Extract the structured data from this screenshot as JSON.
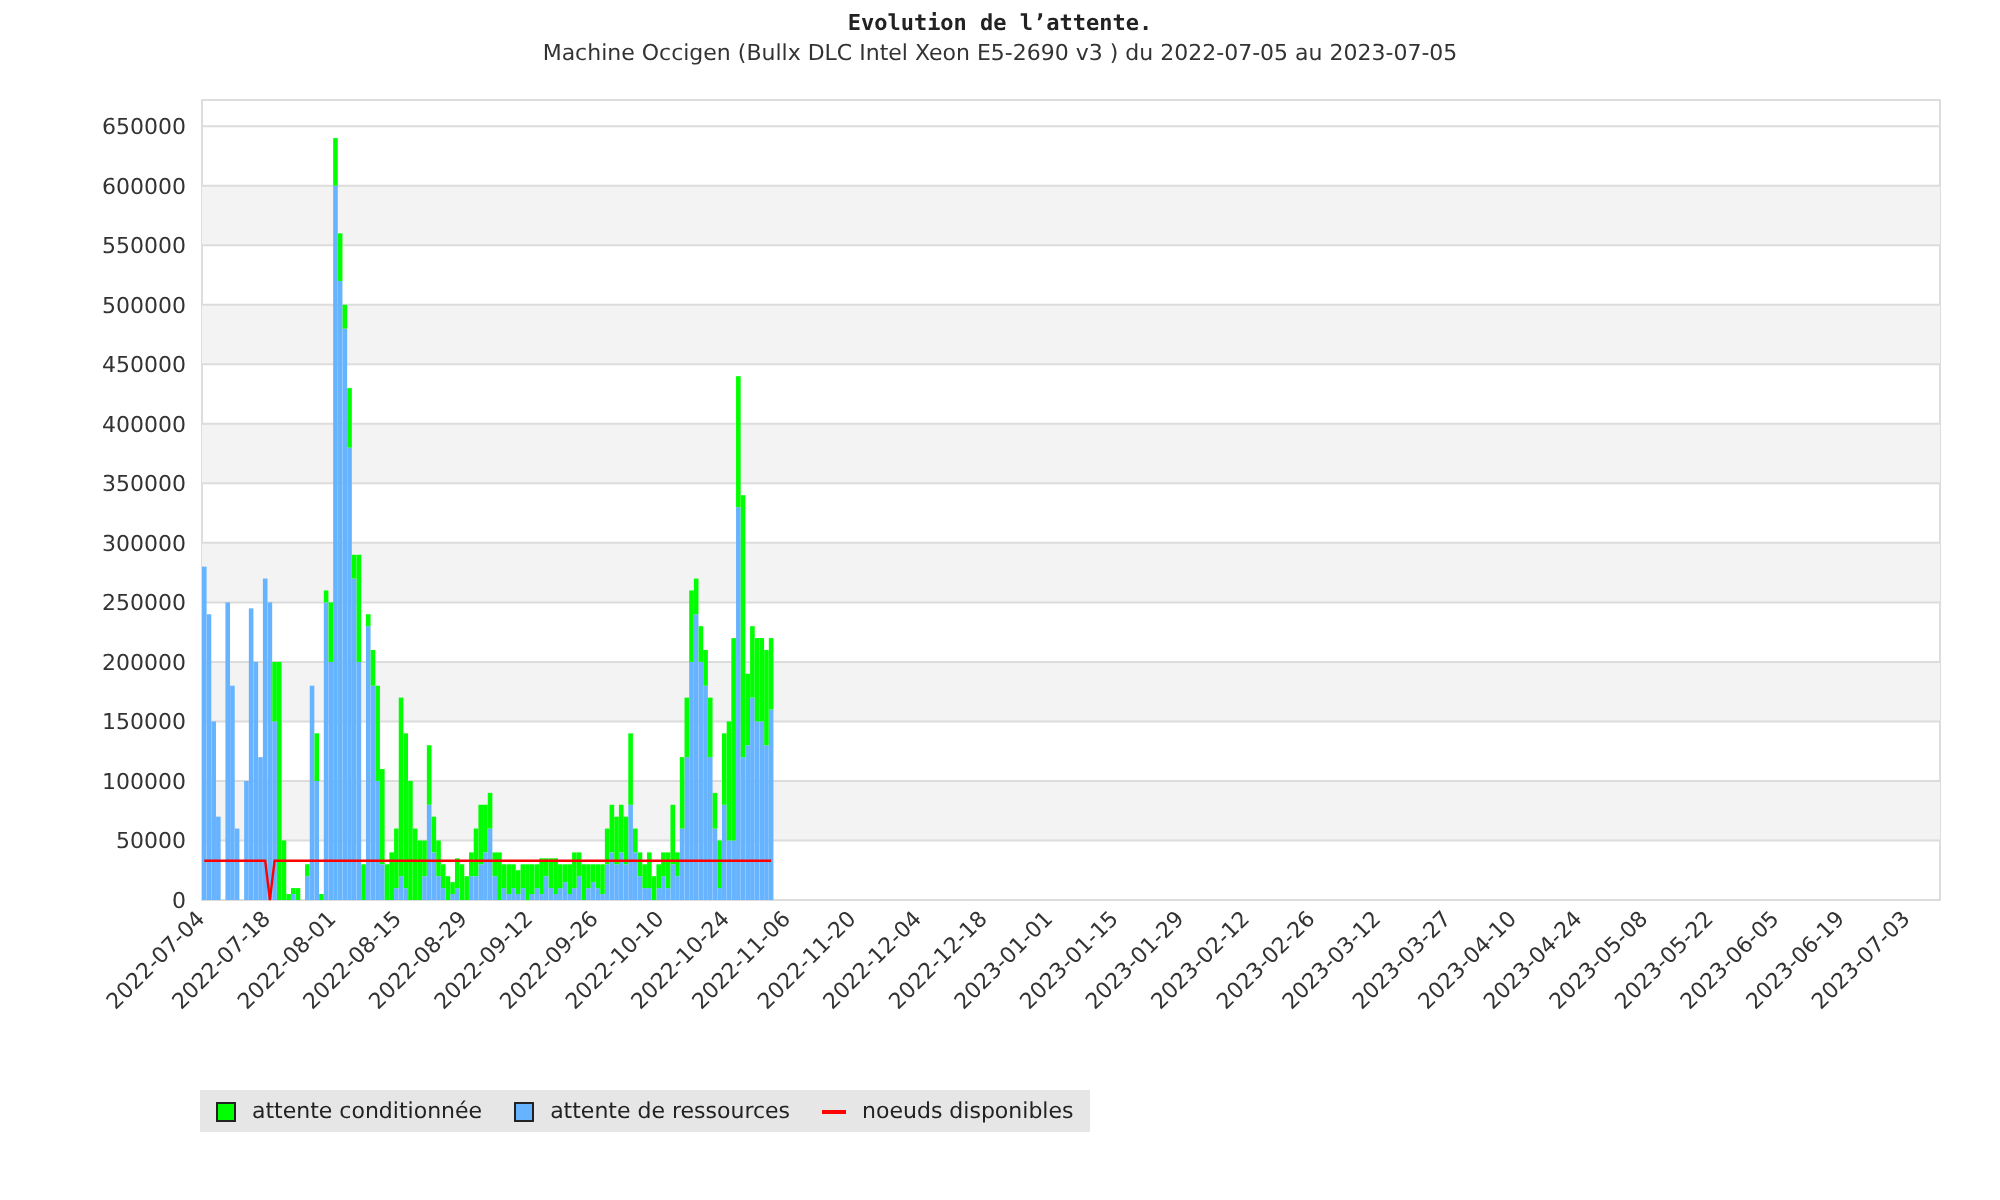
{
  "title": "Evolution de l’attente.",
  "subtitle": "Machine Occigen (Bullx DLC  Intel Xeon E5-2690 v3 ) du 2022-07-05 au 2023-07-05",
  "chart_data": {
    "type": "bar",
    "stacked": true,
    "grid": true,
    "categories": [
      "2022-07-04",
      null,
      null,
      null,
      null,
      null,
      null,
      null,
      null,
      null,
      null,
      null,
      null,
      null,
      "2022-07-18",
      null,
      null,
      null,
      null,
      null,
      null,
      null,
      null,
      null,
      null,
      null,
      null,
      null,
      "2022-08-01",
      null,
      null,
      null,
      null,
      null,
      null,
      null,
      null,
      null,
      null,
      null,
      null,
      null,
      "2022-08-15",
      null,
      null,
      null,
      null,
      null,
      null,
      null,
      null,
      null,
      null,
      null,
      null,
      null,
      "2022-08-29",
      null,
      null,
      null,
      null,
      null,
      null,
      null,
      null,
      null,
      null,
      null,
      null,
      null,
      "2022-09-12",
      null,
      null,
      null,
      null,
      null,
      null,
      null,
      null,
      null,
      null,
      null,
      null,
      null,
      "2022-09-26",
      null,
      null,
      null,
      null,
      null,
      null,
      null,
      null,
      null,
      null,
      null,
      null,
      null,
      "2022-10-10",
      null,
      null,
      null,
      null,
      null,
      null,
      null,
      null,
      null,
      null,
      null,
      null,
      null,
      "2022-10-24",
      null,
      null,
      null,
      null,
      null,
      null,
      null,
      null,
      null,
      null,
      null,
      null,
      "2022-11-06",
      null,
      null,
      null,
      null,
      null,
      null,
      null,
      null,
      null,
      null,
      null,
      null,
      null,
      "2022-11-20",
      null,
      null,
      null,
      null,
      null,
      null,
      null,
      null,
      null,
      null,
      null,
      null,
      null,
      "2022-12-04",
      null,
      null,
      null,
      null,
      null,
      null,
      null,
      null,
      null,
      null,
      null,
      null,
      null,
      "2022-12-18",
      null,
      null,
      null,
      null,
      null,
      null,
      null,
      null,
      null,
      null,
      null,
      null,
      null,
      "2023-01-01",
      null,
      null,
      null,
      null,
      null,
      null,
      null,
      null,
      null,
      null,
      null,
      null,
      null,
      "2023-01-15",
      null,
      null,
      null,
      null,
      null,
      null,
      null,
      null,
      null,
      null,
      null,
      null,
      null,
      "2023-01-29",
      null,
      null,
      null,
      null,
      null,
      null,
      null,
      null,
      null,
      null,
      null,
      null,
      null,
      "2023-02-12",
      null,
      null,
      null,
      null,
      null,
      null,
      null,
      null,
      null,
      null,
      null,
      null,
      null,
      "2023-02-26",
      null,
      null,
      null,
      null,
      null,
      null,
      null,
      null,
      null,
      null,
      null,
      null,
      null,
      "2023-03-12",
      null,
      null,
      null,
      null,
      null,
      null,
      null,
      null,
      null,
      null,
      null,
      null,
      null,
      null,
      "2023-03-27",
      null,
      null,
      null,
      null,
      null,
      null,
      null,
      null,
      null,
      null,
      null,
      null,
      null,
      "2023-04-10",
      null,
      null,
      null,
      null,
      null,
      null,
      null,
      null,
      null,
      null,
      null,
      null,
      null,
      "2023-04-24",
      null,
      null,
      null,
      null,
      null,
      null,
      null,
      null,
      null,
      null,
      null,
      null,
      null,
      "2023-05-08",
      null,
      null,
      null,
      null,
      null,
      null,
      null,
      null,
      null,
      null,
      null,
      null,
      null,
      "2023-05-22",
      null,
      null,
      null,
      null,
      null,
      null,
      null,
      null,
      null,
      null,
      null,
      null,
      null,
      "2023-06-05",
      null,
      null,
      null,
      null,
      null,
      null,
      null,
      null,
      null,
      null,
      null,
      null,
      null,
      "2023-06-19",
      null,
      null,
      null,
      null,
      null,
      null,
      null,
      null,
      null,
      null,
      null,
      null,
      null,
      "2023-07-03"
    ],
    "ylim": [
      0,
      672000
    ],
    "yticks": [
      0,
      50000,
      100000,
      150000,
      200000,
      250000,
      300000,
      350000,
      400000,
      450000,
      500000,
      550000,
      600000,
      650000
    ],
    "series": [
      {
        "name": "attente conditionnée",
        "color": "#00ff00",
        "type": "bar",
        "values": [
          0,
          0,
          0,
          0,
          0,
          0,
          0,
          0,
          0,
          0,
          0,
          0,
          0,
          0,
          0,
          50000,
          200000,
          50000,
          5000,
          5000,
          10000,
          0,
          10000,
          0,
          40000,
          5000,
          10000,
          50000,
          40000,
          40000,
          20000,
          50000,
          20000,
          90000,
          30000,
          10000,
          30000,
          80000,
          80000,
          30000,
          40000,
          50000,
          150000,
          130000,
          100000,
          60000,
          50000,
          30000,
          50000,
          30000,
          30000,
          20000,
          20000,
          10000,
          25000,
          30000,
          20000,
          20000,
          40000,
          50000,
          40000,
          30000,
          20000,
          40000,
          20000,
          25000,
          20000,
          20000,
          20000,
          30000,
          25000,
          20000,
          30000,
          15000,
          25000,
          30000,
          20000,
          15000,
          25000,
          30000,
          20000,
          30000,
          20000,
          15000,
          20000,
          25000,
          30000,
          40000,
          40000,
          40000,
          40000,
          60000,
          20000,
          20000,
          20000,
          30000,
          20000,
          20000,
          20000,
          30000,
          50000,
          20000,
          60000,
          50000,
          60000,
          30000,
          30000,
          30000,
          50000,
          30000,
          40000,
          60000,
          100000,
          170000,
          110000,
          220000,
          60000,
          60000,
          70000,
          70000,
          80000,
          60000,
          null,
          null,
          null,
          null,
          null,
          null,
          null,
          null,
          null,
          null,
          null,
          null,
          null,
          null,
          null,
          null,
          null,
          null,
          null,
          null,
          null,
          null,
          null,
          null,
          null,
          null,
          null,
          null,
          null,
          null,
          null,
          null,
          null,
          null,
          null,
          null,
          null,
          null,
          null,
          null,
          null,
          null,
          null,
          null,
          null,
          null,
          null,
          null,
          null,
          null,
          null,
          null,
          null,
          null,
          null,
          null,
          null,
          null,
          null,
          null,
          null,
          null,
          null,
          null,
          null,
          null,
          null,
          null,
          null,
          null,
          null,
          null,
          null,
          null,
          null,
          null,
          null,
          null,
          null,
          null,
          null,
          null,
          null,
          null,
          null,
          null,
          null,
          null,
          null,
          null,
          null,
          null,
          null,
          null,
          null,
          null,
          null,
          null,
          null,
          null,
          null,
          null,
          null,
          null,
          null,
          null,
          null,
          null,
          null,
          null,
          null,
          null,
          null,
          null,
          null,
          null,
          null,
          null,
          null,
          null,
          null,
          null,
          null,
          null,
          null,
          null,
          null,
          null,
          null,
          null,
          null,
          null,
          null,
          null,
          null,
          null,
          null,
          null,
          null,
          null,
          null,
          null,
          null,
          null,
          null,
          null,
          null,
          null,
          null,
          null,
          null,
          null,
          null,
          null,
          null,
          null,
          null,
          null,
          null,
          null,
          null,
          null,
          null,
          null,
          null,
          null,
          null,
          null,
          null,
          null,
          null,
          null,
          null,
          null,
          null,
          null,
          null,
          null,
          null,
          null,
          null,
          null,
          null,
          null,
          null,
          null,
          null,
          null,
          null,
          null,
          null,
          null,
          null,
          null,
          null,
          null,
          null,
          null,
          null,
          null,
          null,
          null,
          null,
          null,
          null,
          null,
          null,
          null,
          null,
          null,
          null,
          null,
          null,
          null,
          null,
          null,
          null,
          null,
          null,
          null,
          null,
          null,
          null,
          null,
          null,
          null,
          null,
          null,
          null,
          null,
          null,
          null,
          null,
          null,
          null,
          null,
          null,
          null,
          null,
          null,
          null,
          null,
          null
        ]
      },
      {
        "name": "attente de ressources",
        "color": "#66b3ff",
        "type": "bar",
        "values": [
          280000,
          240000,
          150000,
          70000,
          0,
          250000,
          180000,
          60000,
          0,
          100000,
          245000,
          200000,
          120000,
          270000,
          250000,
          150000,
          0,
          0,
          0,
          5000,
          0,
          0,
          20000,
          180000,
          100000,
          0,
          250000,
          200000,
          600000,
          520000,
          480000,
          380000,
          270000,
          200000,
          0,
          230000,
          180000,
          100000,
          30000,
          0,
          0,
          10000,
          20000,
          10000,
          0,
          0,
          0,
          20000,
          80000,
          40000,
          20000,
          10000,
          0,
          5000,
          10000,
          0,
          0,
          20000,
          20000,
          30000,
          40000,
          60000,
          20000,
          0,
          10000,
          5000,
          10000,
          5000,
          10000,
          0,
          5000,
          10000,
          5000,
          20000,
          10000,
          5000,
          10000,
          15000,
          5000,
          10000,
          20000,
          0,
          10000,
          15000,
          10000,
          5000,
          30000,
          40000,
          30000,
          40000,
          30000,
          80000,
          40000,
          20000,
          10000,
          10000,
          0,
          10000,
          20000,
          10000,
          30000,
          20000,
          60000,
          120000,
          200000,
          240000,
          200000,
          180000,
          120000,
          60000,
          10000,
          80000,
          50000,
          50000,
          330000,
          120000,
          130000,
          170000,
          150000,
          150000,
          130000,
          160000,
          null,
          null,
          null,
          null,
          null,
          null,
          null,
          null,
          null,
          null,
          null,
          null,
          null,
          null,
          null,
          null,
          null,
          null,
          null,
          null,
          null,
          null,
          null,
          null,
          null,
          null,
          null,
          null,
          null,
          null,
          null,
          null,
          null,
          null,
          null,
          null,
          null,
          null,
          null,
          null,
          null,
          null,
          null,
          null,
          null,
          null,
          null,
          null,
          null,
          null,
          null,
          null,
          null,
          null,
          null,
          null,
          null,
          null,
          null,
          null,
          null,
          null,
          null,
          null,
          null,
          null,
          null,
          null,
          null,
          null,
          null,
          null,
          null,
          null,
          null,
          null,
          null,
          null,
          null,
          null,
          null,
          null,
          null,
          null,
          null,
          null,
          null,
          null,
          null,
          null,
          null,
          null,
          null,
          null,
          null,
          null,
          null,
          null,
          null,
          null,
          null,
          null,
          null,
          null,
          null,
          null,
          null,
          null,
          null,
          null,
          null,
          null,
          null,
          null,
          null,
          null,
          null,
          null,
          null,
          null,
          null,
          null,
          null,
          null,
          null,
          null,
          null,
          null,
          null,
          null,
          null,
          null,
          null,
          null,
          null,
          null,
          null,
          null,
          null,
          null,
          null,
          null,
          null,
          null,
          null,
          null,
          null,
          null,
          null,
          null,
          null,
          null,
          null,
          null,
          null,
          null,
          null,
          null,
          null,
          null,
          null,
          null,
          null,
          null,
          null,
          null,
          null,
          null,
          null,
          null,
          null,
          null,
          null,
          null,
          null,
          null,
          null,
          null,
          null,
          null,
          null,
          null,
          null,
          null,
          null,
          null,
          null,
          null,
          null,
          null,
          null,
          null,
          null,
          null,
          null,
          null,
          null,
          null,
          null,
          null,
          null,
          null,
          null,
          null,
          null,
          null,
          null,
          null,
          null,
          null,
          null,
          null,
          null,
          null,
          null,
          null,
          null,
          null,
          null,
          null,
          null,
          null,
          null,
          null,
          null,
          null,
          null,
          null,
          null,
          null,
          null,
          null,
          null,
          null,
          null,
          null,
          null,
          null,
          null,
          null,
          null,
          null,
          null
        ]
      },
      {
        "name": "noeuds disponibles",
        "color": "#ff0000",
        "type": "line",
        "values": [
          33000,
          33000,
          33000,
          33000,
          33000,
          33000,
          33000,
          33000,
          33000,
          33000,
          33000,
          33000,
          33000,
          33000,
          0,
          33000,
          33000,
          33000,
          33000,
          33000,
          33000,
          33000,
          33000,
          33000,
          33000,
          33000,
          33000,
          33000,
          33000,
          33000,
          33000,
          33000,
          33000,
          33000,
          33000,
          33000,
          33000,
          33000,
          33000,
          33000,
          33000,
          33000,
          33000,
          33000,
          33000,
          33000,
          33000,
          33000,
          33000,
          33000,
          33000,
          33000,
          33000,
          33000,
          33000,
          33000,
          33000,
          33000,
          33000,
          33000,
          33000,
          33000,
          33000,
          33000,
          33000,
          33000,
          33000,
          33000,
          33000,
          33000,
          33000,
          33000,
          33000,
          33000,
          33000,
          33000,
          33000,
          33000,
          33000,
          33000,
          33000,
          33000,
          33000,
          33000,
          33000,
          33000,
          33000,
          33000,
          33000,
          33000,
          33000,
          33000,
          33000,
          33000,
          33000,
          33000,
          33000,
          33000,
          33000,
          33000,
          33000,
          33000,
          33000,
          33000,
          33000,
          33000,
          33000,
          33000,
          33000,
          33000,
          33000,
          33000,
          33000,
          33000,
          33000,
          33000,
          33000,
          33000,
          33000,
          33000,
          33000,
          33000,
          null,
          null,
          null,
          null,
          null,
          null,
          null,
          null,
          null,
          null,
          null,
          null,
          null,
          null,
          null,
          null,
          null,
          null,
          null,
          null,
          null,
          null,
          null,
          null,
          null,
          null,
          null,
          null,
          null,
          null,
          null,
          null,
          null,
          null,
          null,
          null,
          null,
          null,
          null,
          null,
          null,
          null,
          null,
          null,
          null,
          null,
          null,
          null,
          null,
          null,
          null,
          null,
          null,
          null,
          null,
          null,
          null,
          null,
          null,
          null,
          null,
          null,
          null,
          null,
          null,
          null,
          null,
          null,
          null,
          null,
          null,
          null,
          null,
          null,
          null,
          null,
          null,
          null,
          null,
          null,
          null,
          null,
          null,
          null,
          null,
          null,
          null,
          null,
          null,
          null,
          null,
          null,
          null,
          null,
          null,
          null,
          null,
          null,
          null,
          null,
          null,
          null,
          null,
          null,
          null,
          null,
          null,
          null,
          null,
          null,
          null,
          null,
          null,
          null,
          null,
          null,
          null,
          null,
          null,
          null,
          null,
          null,
          null,
          null,
          null,
          null,
          null,
          null,
          null,
          null,
          null,
          null,
          null,
          null,
          null,
          null,
          null,
          null,
          null,
          null,
          null,
          null,
          null,
          null,
          null,
          null,
          null,
          null,
          null,
          null,
          null,
          null,
          null,
          null,
          null,
          null,
          null,
          null,
          null,
          null,
          null,
          null,
          null,
          null,
          null,
          null,
          null,
          null,
          null,
          null,
          null,
          null,
          null,
          null,
          null,
          null,
          null,
          null,
          null,
          null,
          null,
          null,
          null,
          null,
          null,
          null,
          null,
          null,
          null,
          null,
          null,
          null,
          null,
          null,
          null,
          null,
          null,
          null,
          null,
          null,
          null,
          null,
          null,
          null,
          null,
          null,
          null,
          null,
          null,
          null,
          null,
          null,
          null,
          null,
          null,
          null,
          null,
          null,
          null,
          null,
          null,
          null,
          null,
          null,
          null,
          null,
          null,
          null,
          null,
          null,
          null,
          null,
          null,
          null,
          null,
          null,
          null,
          null,
          null,
          null,
          null,
          null,
          null
        ]
      }
    ]
  }
}
